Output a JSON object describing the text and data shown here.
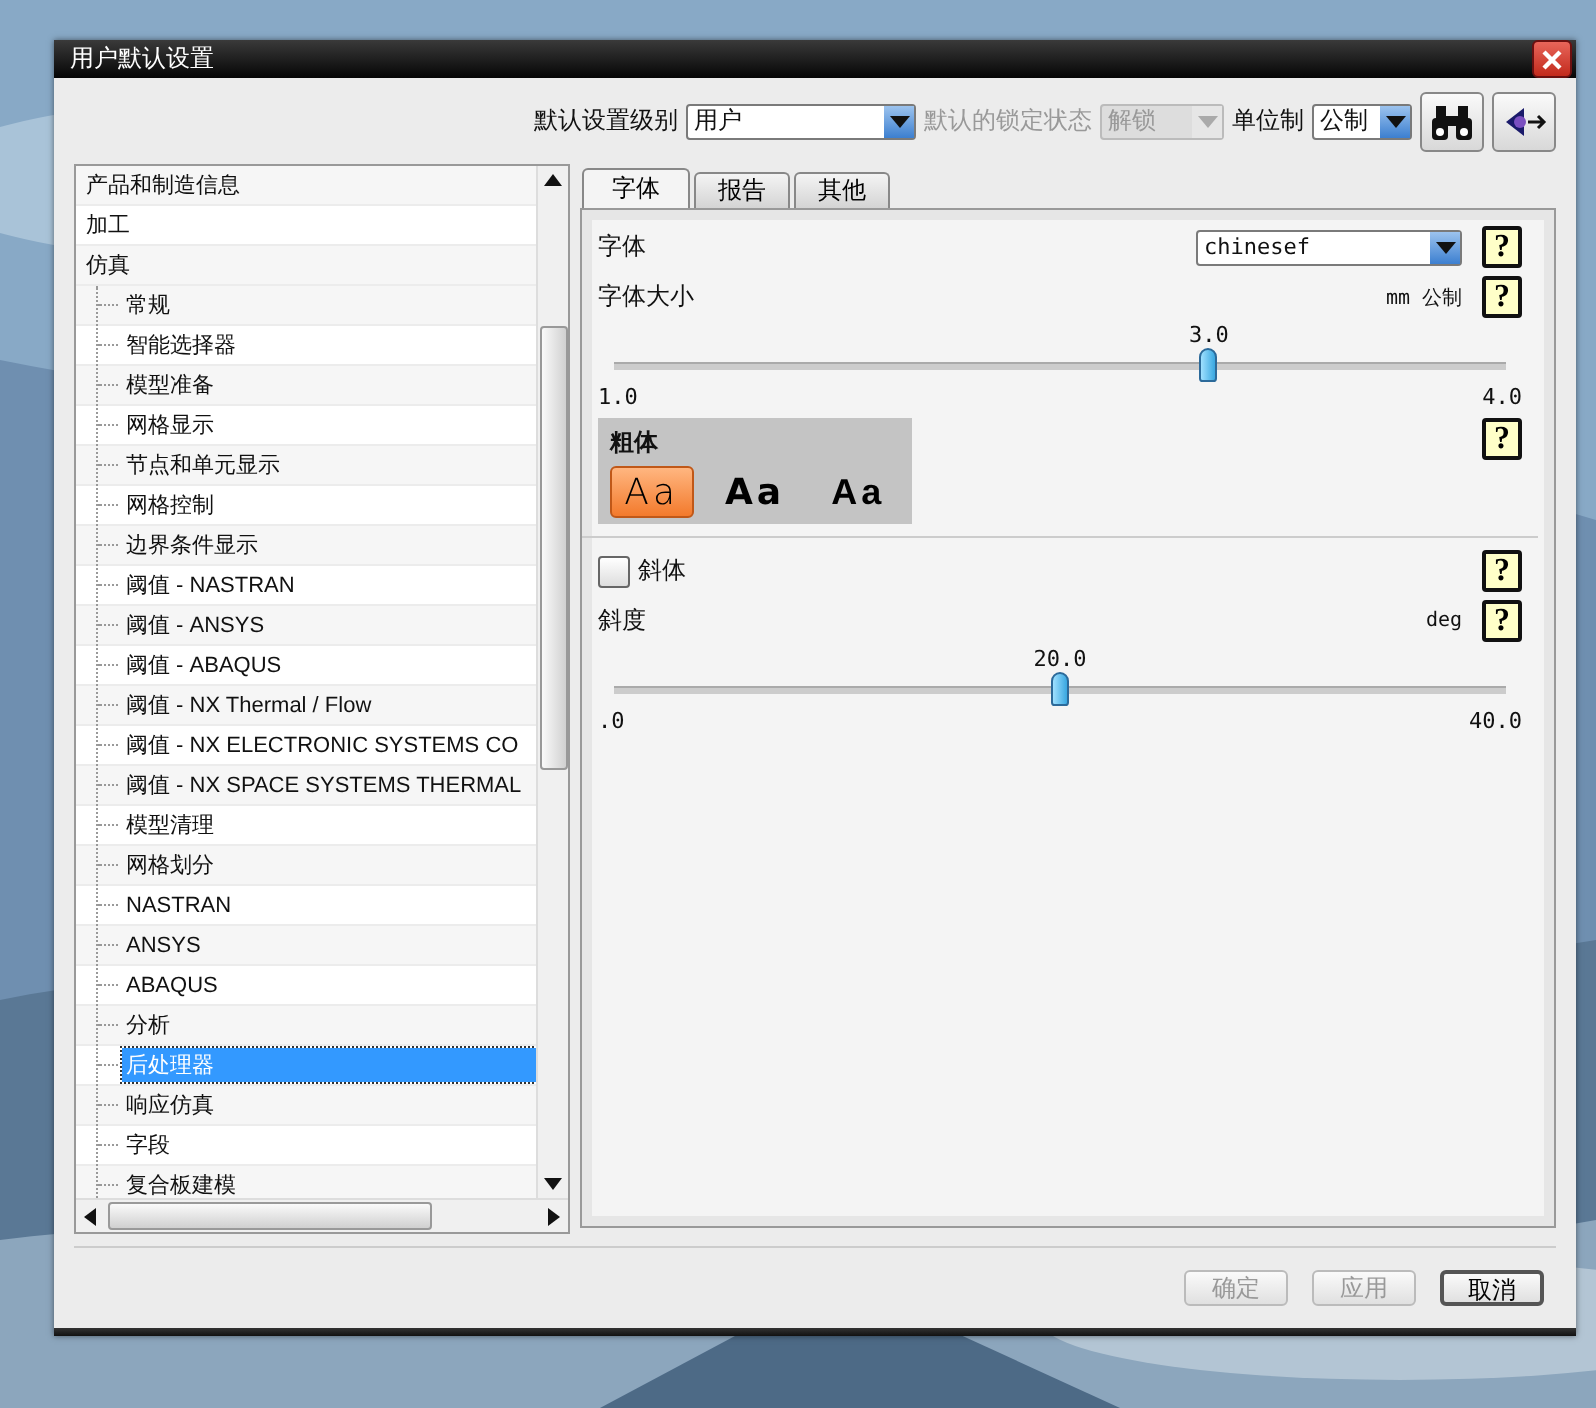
{
  "window": {
    "title": "用户默认设置"
  },
  "toolbar": {
    "level_label": "默认设置级别",
    "level_value": "用户",
    "lock_label": "默认的锁定状态",
    "lock_value": "解锁",
    "lock_disabled": true,
    "units_label": "单位制",
    "units_value": "公制"
  },
  "tree": [
    {
      "label": "产品和制造信息",
      "selected": false
    },
    {
      "label": "加工",
      "selected": false
    },
    {
      "label": "仿真",
      "selected": false,
      "children": [
        {
          "label": "常规",
          "selected": false
        },
        {
          "label": "智能选择器",
          "selected": false
        },
        {
          "label": "模型准备",
          "selected": false
        },
        {
          "label": "网格显示",
          "selected": false
        },
        {
          "label": "节点和单元显示",
          "selected": false
        },
        {
          "label": "网格控制",
          "selected": false
        },
        {
          "label": "边界条件显示",
          "selected": false
        },
        {
          "label": "阈值 - NASTRAN",
          "selected": false
        },
        {
          "label": "阈值 - ANSYS",
          "selected": false
        },
        {
          "label": "阈值 - ABAQUS",
          "selected": false
        },
        {
          "label": "阈值 - NX Thermal / Flow",
          "selected": false
        },
        {
          "label": "阈值 - NX ELECTRONIC SYSTEMS CO",
          "selected": false
        },
        {
          "label": "阈值 - NX SPACE SYSTEMS THERMAL",
          "selected": false
        },
        {
          "label": "模型清理",
          "selected": false
        },
        {
          "label": "网格划分",
          "selected": false
        },
        {
          "label": "NASTRAN",
          "selected": false
        },
        {
          "label": "ANSYS",
          "selected": false
        },
        {
          "label": "ABAQUS",
          "selected": false
        },
        {
          "label": "分析",
          "selected": false
        },
        {
          "label": "后处理器",
          "selected": true
        },
        {
          "label": "响应仿真",
          "selected": false
        },
        {
          "label": "字段",
          "selected": false
        },
        {
          "label": "复合板建模",
          "selected": false
        }
      ]
    }
  ],
  "tabs": [
    {
      "label": "字体",
      "selected": true
    },
    {
      "label": "报告",
      "selected": false
    },
    {
      "label": "其他",
      "selected": false
    }
  ],
  "font": {
    "label": "字体",
    "value": "chinesef",
    "help": "?"
  },
  "size": {
    "label": "字体大小",
    "unit": "mm 公制",
    "help": "?",
    "reading": "3.0",
    "min": "1.0",
    "max": "4.0",
    "level": 0.667
  },
  "weight": {
    "label": "粗体",
    "help": "?",
    "options": [
      {
        "label": "Aa",
        "kind": "light",
        "selected": true
      },
      {
        "label": "Aa",
        "kind": "bold",
        "selected": false
      },
      {
        "label": "Aa",
        "kind": "heavy",
        "selected": false
      }
    ]
  },
  "italic": {
    "label": "斜体",
    "checked": false,
    "help": "?"
  },
  "slant": {
    "label": "斜度",
    "unit": "deg",
    "help": "?",
    "reading": "20.0",
    "min": ".0",
    "max": "40.0",
    "level": 0.5
  },
  "buttons": [
    {
      "label": "确定",
      "disabled": true
    },
    {
      "label": "应用",
      "disabled": true
    },
    {
      "label": "取消",
      "disabled": false
    }
  ]
}
